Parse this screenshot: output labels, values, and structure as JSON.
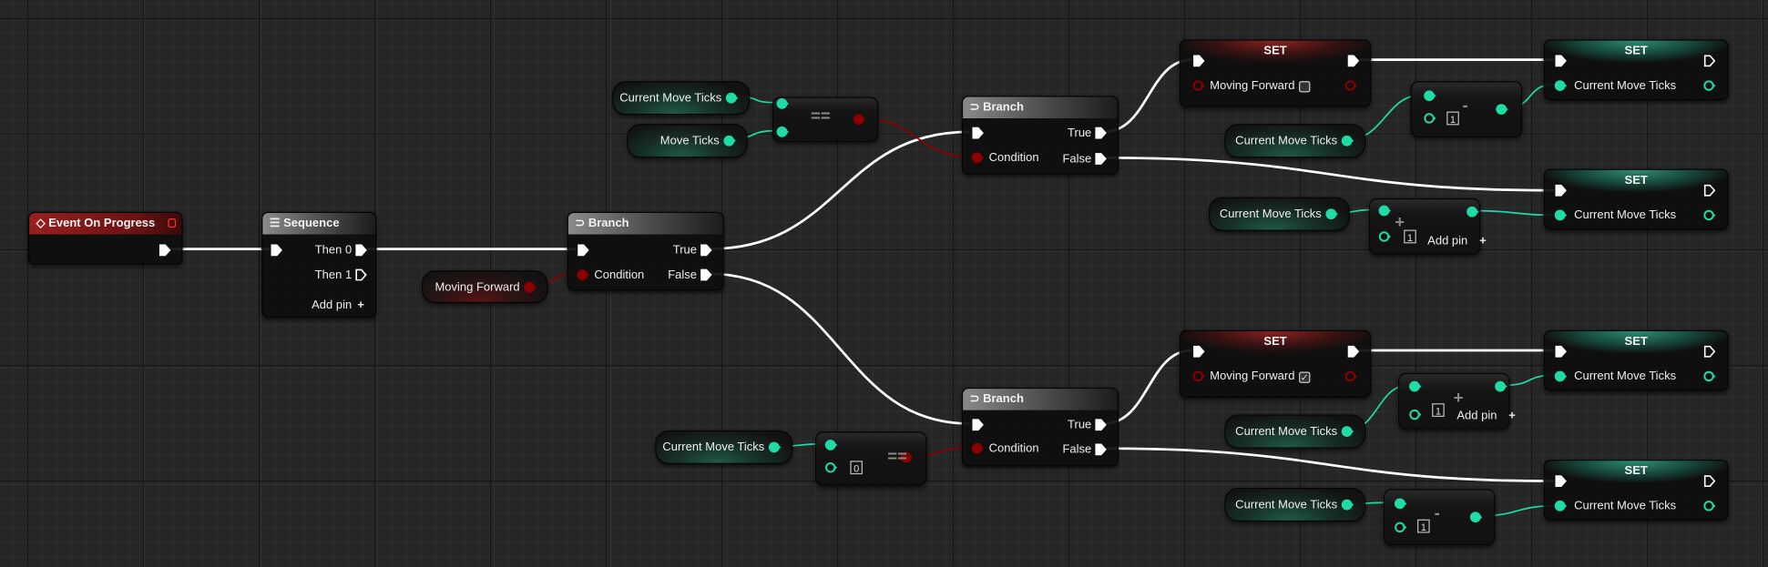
{
  "colors": {
    "exec": "#ffffff",
    "bool": "#8c0000",
    "int": "#1fdca6",
    "event_header": "#8a1a1a",
    "grid_bg": "#262626"
  },
  "icons": {
    "event": "event-diamond-icon",
    "sequence": "sequence-icon",
    "branch": "branch-icon"
  },
  "nodes": [
    {
      "kind": "event",
      "title": "Event On Progress"
    },
    {
      "kind": "sequence",
      "title": "Sequence",
      "pins": [
        "Then 0",
        "Then 1"
      ],
      "add_pin": "Add pin"
    },
    {
      "kind": "branch",
      "title": "Branch",
      "condition": "Condition",
      "true": "True",
      "false": "False"
    },
    {
      "kind": "getter",
      "variable": "Moving Forward",
      "type": "bool"
    },
    {
      "kind": "getter",
      "variable": "Current Move Ticks",
      "type": "int"
    },
    {
      "kind": "getter",
      "variable": "Move Ticks",
      "type": "int"
    },
    {
      "kind": "operator",
      "op": "=="
    },
    {
      "kind": "branch",
      "title": "Branch",
      "condition": "Condition",
      "true": "True",
      "false": "False"
    },
    {
      "kind": "set",
      "title": "SET",
      "variable": "Moving Forward",
      "value": false
    },
    {
      "kind": "set",
      "title": "SET",
      "variable": "Current Move Ticks"
    },
    {
      "kind": "getter",
      "variable": "Current Move Ticks",
      "type": "int"
    },
    {
      "kind": "operator",
      "op": "-",
      "literal": "1"
    },
    {
      "kind": "set",
      "title": "SET",
      "variable": "Current Move Ticks"
    },
    {
      "kind": "getter",
      "variable": "Current Move Ticks",
      "type": "int"
    },
    {
      "kind": "operator",
      "op": "+",
      "literal": "1",
      "add_pin": "Add pin"
    },
    {
      "kind": "set",
      "title": "SET",
      "variable": "Moving Forward",
      "value": true
    },
    {
      "kind": "set",
      "title": "SET",
      "variable": "Current Move Ticks"
    },
    {
      "kind": "getter",
      "variable": "Current Move Ticks",
      "type": "int"
    },
    {
      "kind": "operator",
      "op": "+",
      "literal": "1",
      "add_pin": "Add pin"
    },
    {
      "kind": "branch",
      "title": "Branch",
      "condition": "Condition",
      "true": "True",
      "false": "False"
    },
    {
      "kind": "getter",
      "variable": "Current Move Ticks",
      "type": "int"
    },
    {
      "kind": "operator",
      "op": "==",
      "literal": "0"
    },
    {
      "kind": "set",
      "title": "SET",
      "variable": "Current Move Ticks"
    },
    {
      "kind": "getter",
      "variable": "Current Move Ticks",
      "type": "int"
    },
    {
      "kind": "operator",
      "op": "-",
      "literal": "1"
    }
  ]
}
